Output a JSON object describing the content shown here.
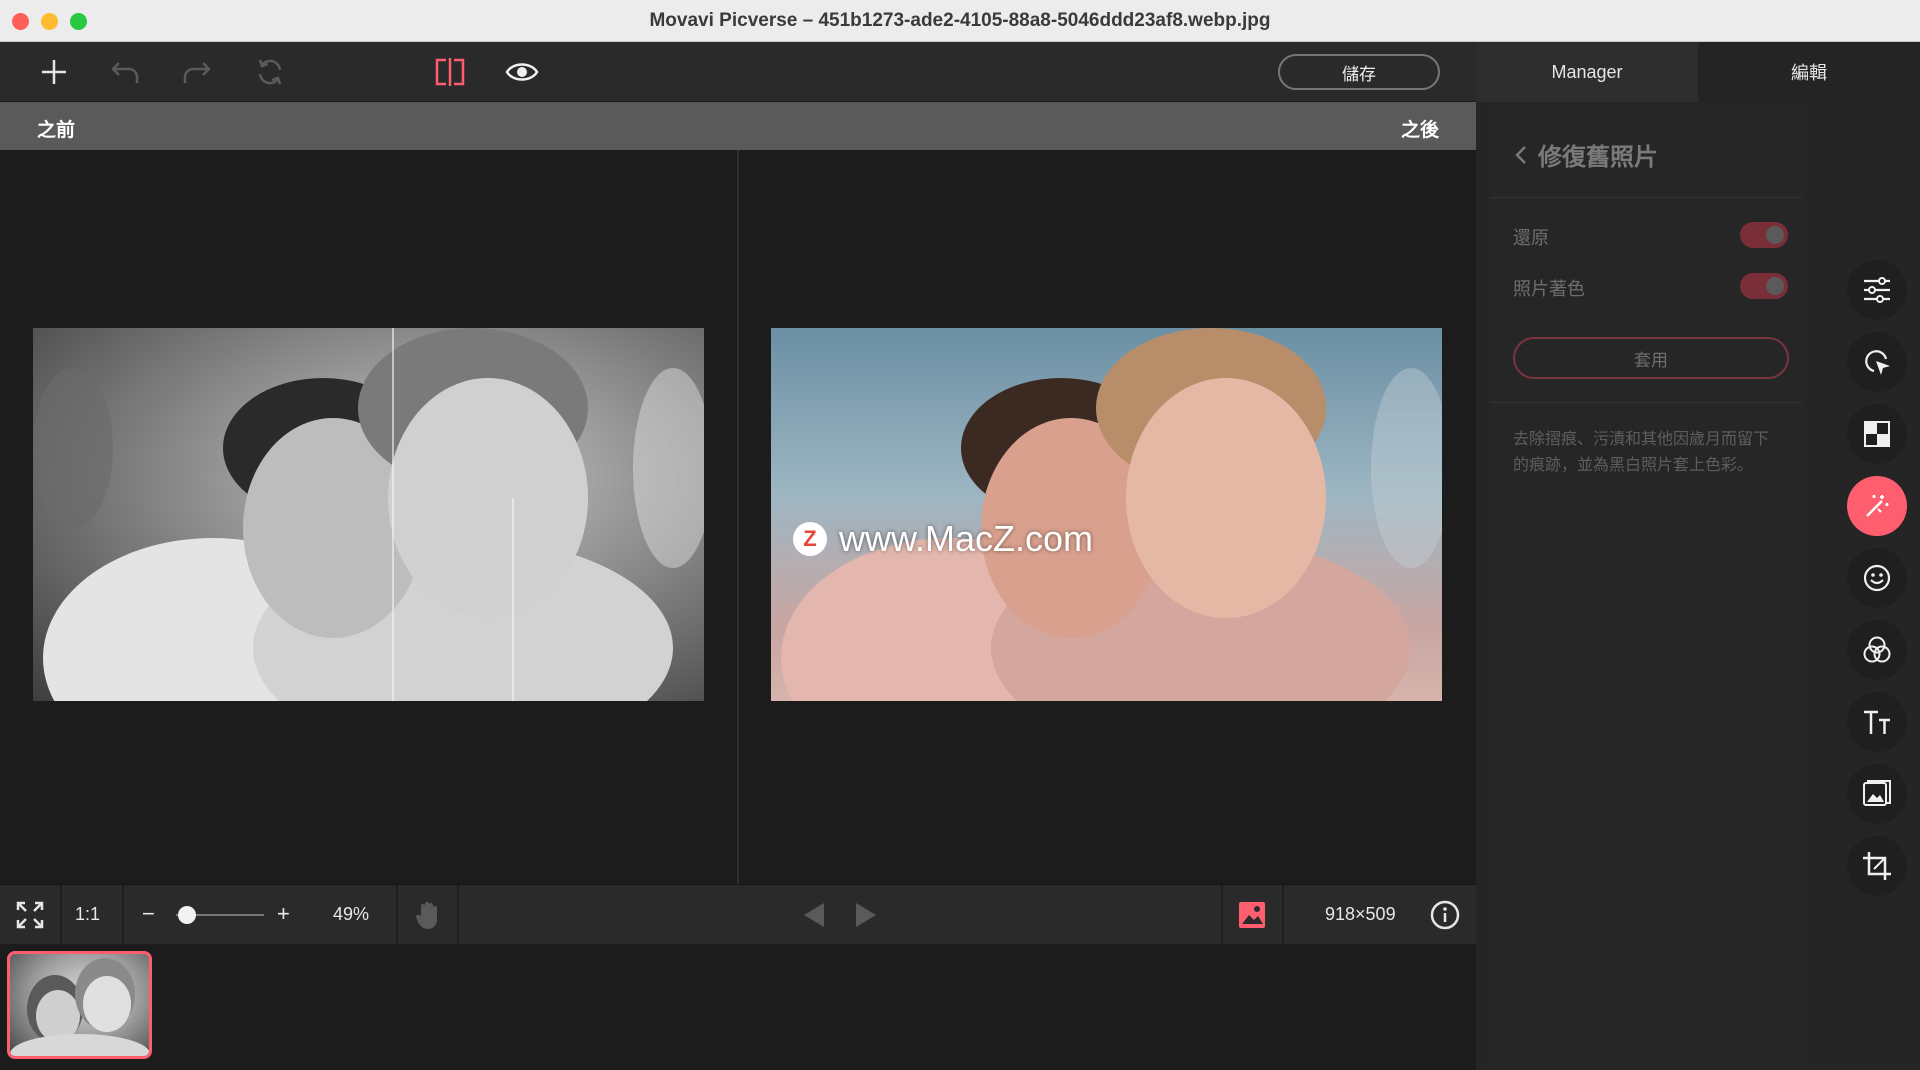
{
  "window": {
    "title": "Movavi Picverse – 451b1273-ade2-4105-88a8-5046ddd23af8.webp.jpg"
  },
  "toolbar": {
    "save_label": "儲存",
    "tabs": [
      {
        "label": "Manager"
      },
      {
        "label": "編輯"
      }
    ],
    "icons": [
      "plus-icon",
      "undo-icon",
      "redo-icon",
      "reset-icon",
      "compare-split-icon",
      "eye-icon"
    ]
  },
  "labels": {
    "before": "之前",
    "after": "之後"
  },
  "watermark": {
    "text": "www.MacZ.com",
    "logo_letter": "Z"
  },
  "bottom_bar": {
    "one_to_one": "1:1",
    "zoom_minus": "−",
    "zoom_plus": "+",
    "zoom_value": "49%",
    "zoom_fraction": 0.12,
    "dimensions": "918×509"
  },
  "panel": {
    "back_title": "修復舊照片",
    "options": [
      {
        "label": "還原",
        "enabled": true
      },
      {
        "label": "照片著色",
        "enabled": true
      }
    ],
    "apply_label": "套用",
    "description": "去除摺痕、污漬和其他因歲月而留下的痕跡，並為黑白照片套上色彩。"
  },
  "colors": {
    "accent": "#ff5e6e",
    "toggle_on": "#7a2e38"
  },
  "tools": [
    "adjust-icon",
    "select-icon",
    "background-icon",
    "restore-magic-icon",
    "face-icon",
    "color-icon",
    "text-icon",
    "image-icon",
    "crop-icon"
  ]
}
